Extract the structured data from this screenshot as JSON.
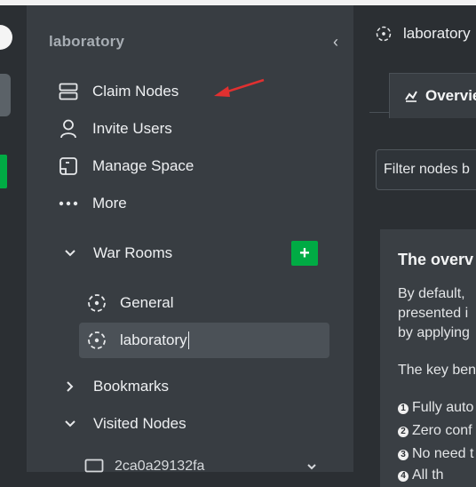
{
  "sidebar": {
    "space_title": "laboratory",
    "nav": [
      {
        "label": "Claim Nodes",
        "icon": "server-icon"
      },
      {
        "label": "Invite Users",
        "icon": "user-icon"
      },
      {
        "label": "Manage Space",
        "icon": "manage-space-icon"
      },
      {
        "label": "More",
        "icon": "more-dots-icon"
      }
    ],
    "war_rooms_label": "War Rooms",
    "add_label": "+",
    "rooms": [
      {
        "label": "General"
      },
      {
        "label": "laboratory",
        "active": true
      }
    ],
    "bookmarks_label": "Bookmarks",
    "visited_nodes_label": "Visited Nodes",
    "visited_node_name": "2ca0a29132fa"
  },
  "main": {
    "room_title": "laboratory",
    "tab_label": "Overvie",
    "filter_placeholder": "Filter nodes b",
    "card": {
      "heading": "The overv",
      "lines": [
        "By default,",
        "presented i",
        "by applying",
        "The key ben"
      ],
      "bullets": [
        "Fully auto",
        "Zero conf",
        "No need t",
        "All th"
      ]
    }
  },
  "colors": {
    "accent_green": "#00ab44",
    "annotation_red": "#e03030"
  }
}
